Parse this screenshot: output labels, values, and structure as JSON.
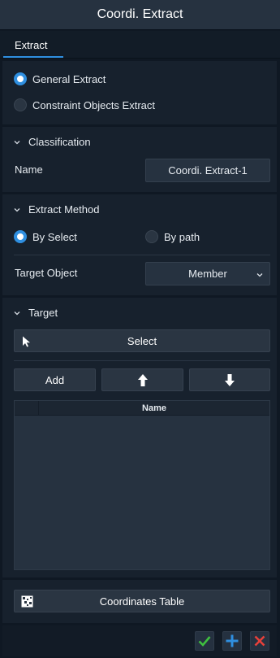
{
  "window": {
    "title": "Coordi. Extract"
  },
  "tabs": [
    {
      "label": "Extract",
      "active": true
    }
  ],
  "extract_type": {
    "options": [
      {
        "label": "General Extract",
        "checked": true
      },
      {
        "label": "Constraint Objects Extract",
        "checked": false
      }
    ]
  },
  "classification": {
    "header": "Classification",
    "name_label": "Name",
    "name_value": "Coordi. Extract-1"
  },
  "extract_method": {
    "header": "Extract Method",
    "options": [
      {
        "label": "By Select",
        "checked": true
      },
      {
        "label": "By path",
        "checked": false
      }
    ],
    "target_object_label": "Target Object",
    "target_object_value": "Member"
  },
  "target": {
    "header": "Target",
    "select_label": "Select",
    "add_label": "Add",
    "table_columns": [
      "Name"
    ],
    "rows": []
  },
  "coordinates_table_label": "Coordinates Table",
  "colors": {
    "accent": "#2f8fe0",
    "ok": "#3fc13f",
    "add": "#2f8fe0",
    "cancel": "#e8403a"
  }
}
